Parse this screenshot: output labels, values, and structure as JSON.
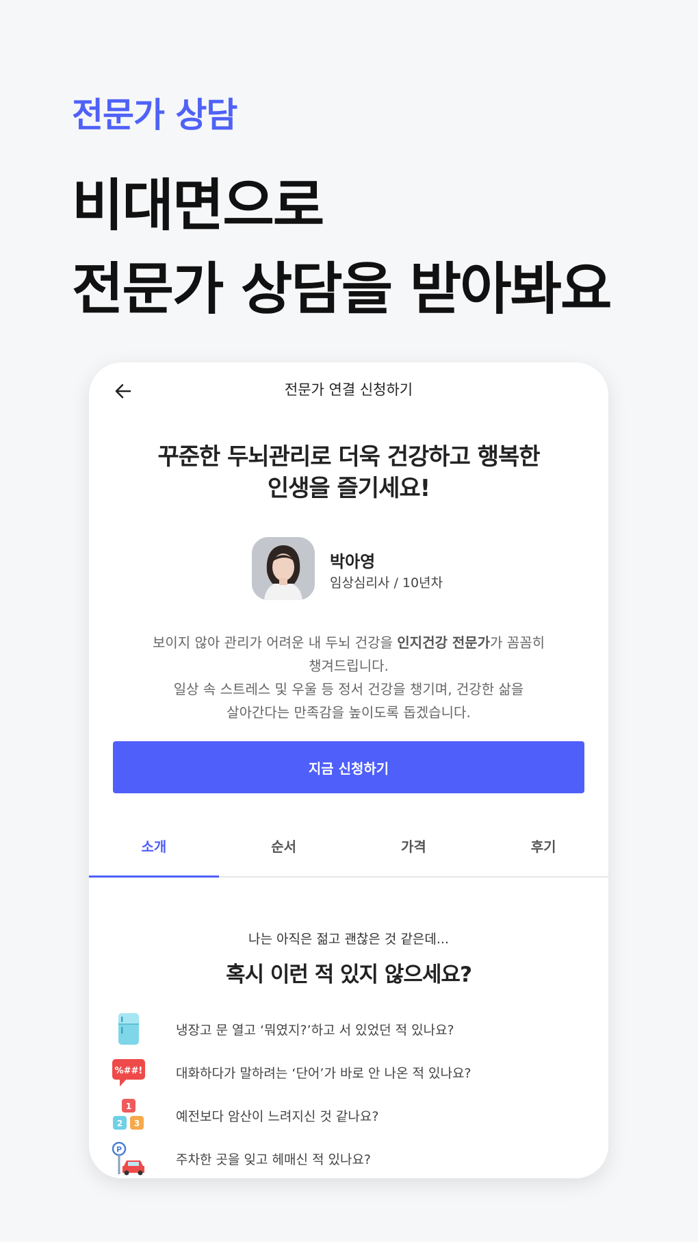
{
  "header": {
    "eyebrow": "전문가 상담",
    "headline_line1": "비대면으로",
    "headline_line2": "전문가 상담을 받아봐요"
  },
  "app": {
    "title": "전문가 연결 신청하기",
    "hero_line1": "꾸준한 두뇌관리로 더욱 건강하고 행복한",
    "hero_line2": "인생을 즐기세요!",
    "expert": {
      "name": "박아영",
      "role": "임상심리사 / 10년차"
    },
    "description": {
      "line1_pre": "보이지 않아 관리가 어려운 내 두뇌 건강을 ",
      "line1_bold": "인지건강 전문가",
      "line1_post": "가 꼼꼼히",
      "line2": "챙겨드립니다.",
      "line3": "일상 속 스트레스 및 우울 등 정서 건강을 챙기며, 건강한 삶을",
      "line4": "살아간다는 만족감을 높이도록 돕겠습니다."
    },
    "cta_label": "지금 신청하기",
    "tabs": [
      {
        "label": "소개",
        "active": true
      },
      {
        "label": "순서",
        "active": false
      },
      {
        "label": "가격",
        "active": false
      },
      {
        "label": "후기",
        "active": false
      }
    ],
    "questions": {
      "lead": "나는 아직은 젊고 괜찮은 것 같은데...",
      "title": "혹시 이런 적 있지 않으세요?",
      "items": [
        {
          "icon": "refrigerator-icon",
          "text": "냉장고 문 열고 ‘뭐였지?’하고 서 있었던 적 있나요?"
        },
        {
          "icon": "speech-bubble-icon",
          "text": "대화하다가 말하려는 ‘단어’가 바로 안 나온 적 있나요?"
        },
        {
          "icon": "number-blocks-icon",
          "text": "예전보다 암산이 느려지신 것 같나요?"
        },
        {
          "icon": "parking-car-icon",
          "text": "주차한 곳을 잊고 헤매신 적 있나요?"
        }
      ]
    }
  },
  "colors": {
    "accent": "#4e5ffa",
    "eyebrow": "#4f62f7",
    "background": "#f6f7f9"
  }
}
